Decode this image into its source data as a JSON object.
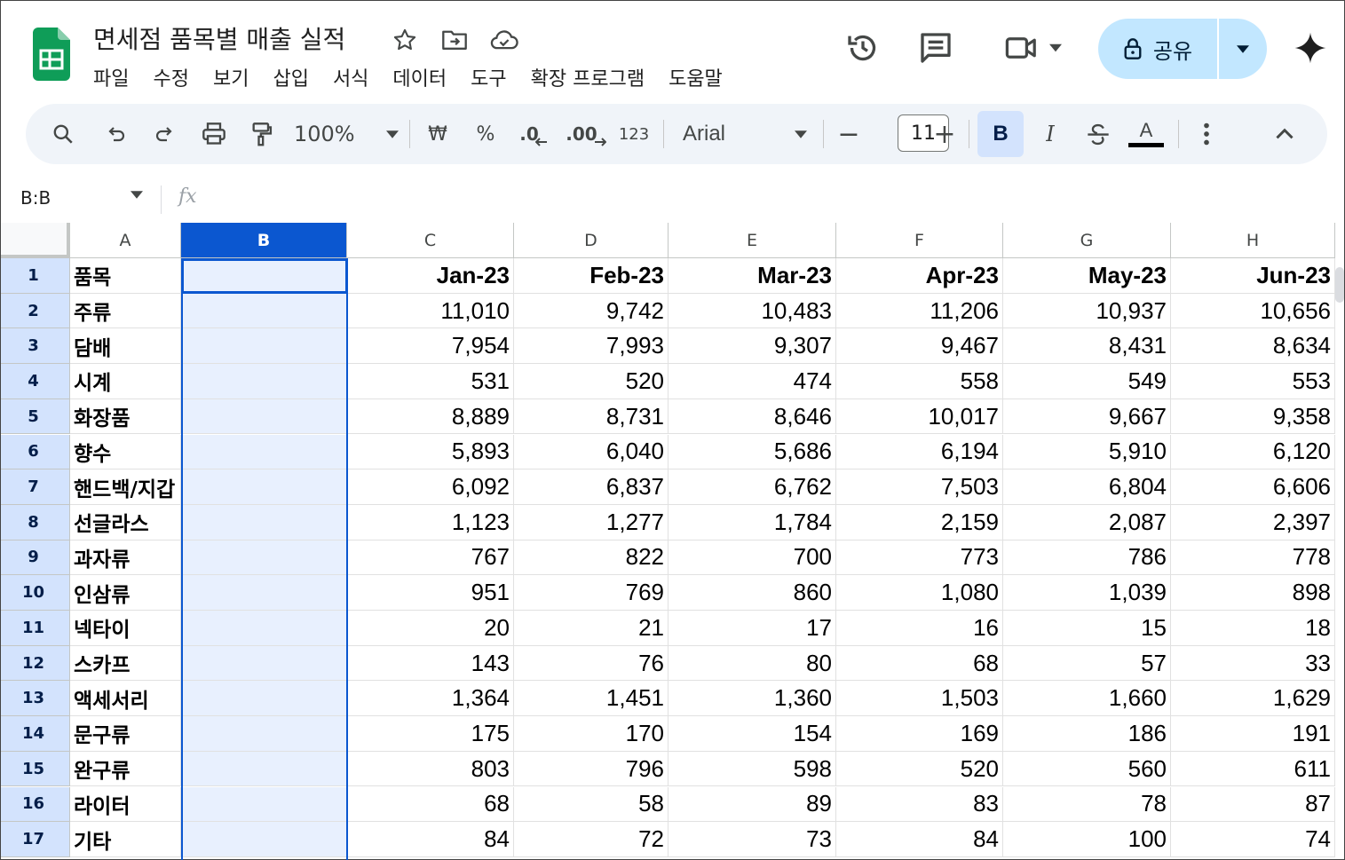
{
  "doc": {
    "title": "면세점 품목별 매출 실적"
  },
  "menu": [
    "파일",
    "수정",
    "보기",
    "삽입",
    "서식",
    "데이터",
    "도구",
    "확장 프로그램",
    "도움말"
  ],
  "share": {
    "label": "공유"
  },
  "toolbar": {
    "zoom": "100%",
    "currency": "₩",
    "percent": "%",
    "dec_decrease": ".0",
    "dec_increase": ".00",
    "format_num": "123",
    "font": "Arial",
    "minus": "−",
    "font_size": "11",
    "plus": "+",
    "bold": "B",
    "italic": "I",
    "text_color": "A"
  },
  "formula_bar": {
    "name_box": "B:B",
    "fx": "fx"
  },
  "grid": {
    "columns": [
      "A",
      "B",
      "C",
      "D",
      "E",
      "F",
      "G",
      "H"
    ],
    "rows": [
      [
        "1",
        "품목",
        "",
        "Jan-23",
        "Feb-23",
        "Mar-23",
        "Apr-23",
        "May-23",
        "Jun-23"
      ],
      [
        "2",
        "주류",
        "",
        "11,010",
        "9,742",
        "10,483",
        "11,206",
        "10,937",
        "10,656"
      ],
      [
        "3",
        "담배",
        "",
        "7,954",
        "7,993",
        "9,307",
        "9,467",
        "8,431",
        "8,634"
      ],
      [
        "4",
        "시계",
        "",
        "531",
        "520",
        "474",
        "558",
        "549",
        "553"
      ],
      [
        "5",
        "화장품",
        "",
        "8,889",
        "8,731",
        "8,646",
        "10,017",
        "9,667",
        "9,358"
      ],
      [
        "6",
        "향수",
        "",
        "5,893",
        "6,040",
        "5,686",
        "6,194",
        "5,910",
        "6,120"
      ],
      [
        "7",
        "핸드백/지갑",
        "",
        "6,092",
        "6,837",
        "6,762",
        "7,503",
        "6,804",
        "6,606"
      ],
      [
        "8",
        "선글라스",
        "",
        "1,123",
        "1,277",
        "1,784",
        "2,159",
        "2,087",
        "2,397"
      ],
      [
        "9",
        "과자류",
        "",
        "767",
        "822",
        "700",
        "773",
        "786",
        "778"
      ],
      [
        "10",
        "인삼류",
        "",
        "951",
        "769",
        "860",
        "1,080",
        "1,039",
        "898"
      ],
      [
        "11",
        "넥타이",
        "",
        "20",
        "21",
        "17",
        "16",
        "15",
        "18"
      ],
      [
        "12",
        "스카프",
        "",
        "143",
        "76",
        "80",
        "68",
        "57",
        "33"
      ],
      [
        "13",
        "액세서리",
        "",
        "1,364",
        "1,451",
        "1,360",
        "1,503",
        "1,660",
        "1,629"
      ],
      [
        "14",
        "문구류",
        "",
        "175",
        "170",
        "154",
        "169",
        "186",
        "191"
      ],
      [
        "15",
        "완구류",
        "",
        "803",
        "796",
        "598",
        "520",
        "560",
        "611"
      ],
      [
        "16",
        "라이터",
        "",
        "68",
        "58",
        "89",
        "83",
        "78",
        "87"
      ],
      [
        "17",
        "기타",
        "",
        "84",
        "72",
        "73",
        "84",
        "100",
        "74"
      ]
    ]
  }
}
